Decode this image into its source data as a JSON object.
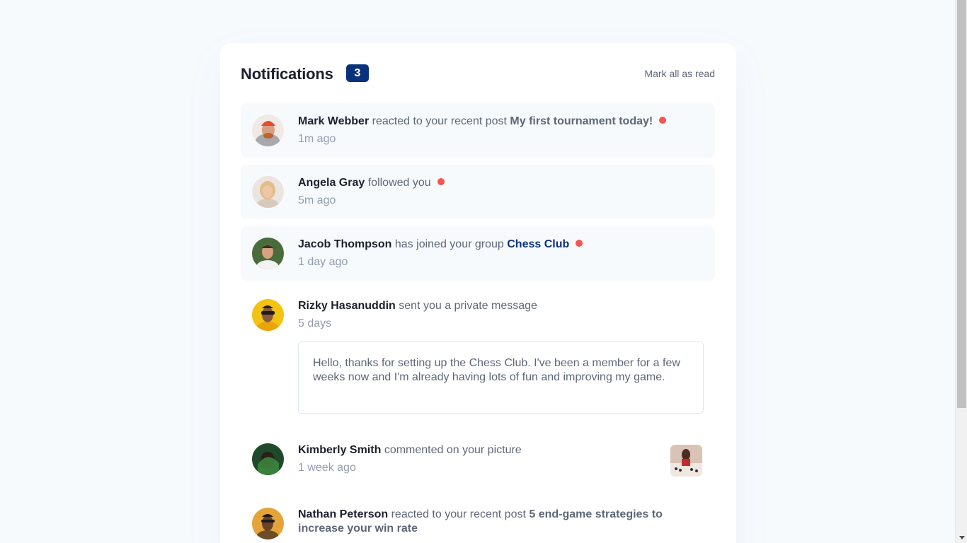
{
  "header": {
    "title": "Notifications",
    "unread_count": "3",
    "mark_all_label": "Mark all as read"
  },
  "notifications": [
    {
      "user": "Mark Webber",
      "action": "reacted to your recent post",
      "target": "My first tournament today!",
      "time": "1m ago",
      "unread": true
    },
    {
      "user": "Angela Gray",
      "action": "followed you",
      "time": "5m ago",
      "unread": true
    },
    {
      "user": "Jacob Thompson",
      "action": "has joined your group",
      "target": "Chess Club",
      "time": "1 day ago",
      "unread": true
    },
    {
      "user": "Rizky Hasanuddin",
      "action": "sent you a private message",
      "time": "5 days",
      "message": "Hello, thanks for setting up the Chess Club. I've been a member for a few weeks now and I'm already having lots of fun and improving my game.",
      "unread": false
    },
    {
      "user": "Kimberly Smith",
      "action": "commented on your picture",
      "time": "1 week ago",
      "unread": false
    },
    {
      "user": "Nathan Peterson",
      "action": "reacted to your recent post",
      "target_line1": "5 end-game strategies to",
      "target_line2": "increase your win rate",
      "unread": false
    }
  ],
  "colors": {
    "badge_bg": "#0a317b",
    "unread_dot": "#f65552",
    "unread_bg": "#f7fafd",
    "name_text": "#1c202b",
    "body_text": "#5e6778",
    "time_text": "#939caf"
  }
}
